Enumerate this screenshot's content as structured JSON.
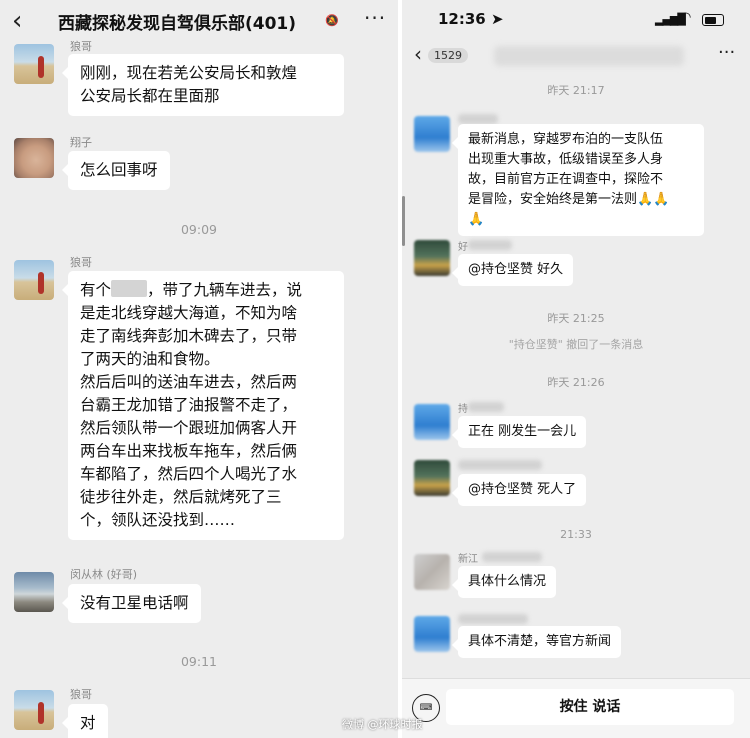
{
  "left": {
    "header": {
      "back": "‹",
      "title": "西藏探秘发现自驾俱乐部(401)",
      "mute": "🔕",
      "more": "···"
    },
    "messages": [
      {
        "sender": "狼哥",
        "text_lines": [
          "刚刚，现在若羌公安局长和敦煌",
          "公安局长都在里面那"
        ]
      },
      {
        "sender": "翔子",
        "text_lines": [
          "怎么回事呀"
        ]
      },
      {
        "sender": "狼哥",
        "text_lines": [
          "有个",
          "，带了九辆车进去，说",
          "是走北线穿越大海道，不知为啥",
          "走了南线奔彭加木碑去了，只带",
          "了两天的油和食物。",
          "然后后叫的送油车进去，然后两",
          "台霸王龙加错了油报警不走了，",
          "然后领队带一个跟班加俩客人开",
          "两台车出来找板车拖车，然后俩",
          "车都陷了，然后四个人喝光了水",
          "徒步往外走，然后就烤死了三",
          "个，领队还没找到……"
        ]
      },
      {
        "sender": "闵从林 (好哥)",
        "text_lines": [
          "没有卫星电话啊"
        ]
      },
      {
        "sender": "狼哥",
        "text_lines": [
          "对"
        ]
      }
    ],
    "times": [
      "09:09",
      "09:11"
    ]
  },
  "right": {
    "status": {
      "clock": "12:36 ➤",
      "signal": "▂▄▆█",
      "wifi": "◠"
    },
    "header": {
      "back": "‹",
      "badge": "1529",
      "more": "···"
    },
    "times": [
      "昨天 21:17",
      "昨天 21:25",
      "昨天 21:26",
      "21:33"
    ],
    "messages": [
      {
        "sender": "",
        "text_lines": [
          "最新消息，穿越罗布泊的一支队伍",
          "出现重大事故，低级错误至多人身",
          "故，目前官方正在调查中，探险不",
          "是冒险，安全始终是第一法则🙏🙏",
          "🙏"
        ]
      },
      {
        "sender": "好",
        "text_lines": [
          "@持仓坚赞 好久"
        ]
      },
      {
        "sender": "持",
        "text_lines": [
          "正在   刚发生一会儿"
        ]
      },
      {
        "sender": "",
        "text_lines": [
          "@持仓坚赞 死人了"
        ]
      },
      {
        "sender": "新江",
        "text_lines": [
          "具体什么情况"
        ]
      },
      {
        "sender": "",
        "text_lines": [
          "具体不清楚，等官方新闻"
        ]
      }
    ],
    "recall_notice": "\"持仓坚赞\" 撤回了一条消息",
    "input": {
      "keyboard": "⌨",
      "press_to_talk": "按住 说话"
    },
    "watermark": "微博 @环球时报"
  }
}
